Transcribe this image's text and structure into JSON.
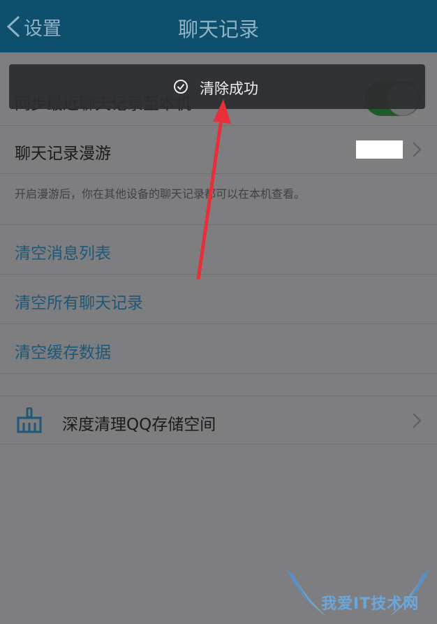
{
  "header": {
    "back_label": "设置",
    "title": "聊天记录"
  },
  "settings": {
    "sync_label": "同步最近聊天记录至本机",
    "sync_enabled": true,
    "roaming_label": "聊天记录漫游",
    "roaming_hint": "开启漫游后，你在其他设备的聊天记录都可以在本机查看。",
    "clear_message_list": "清空消息列表",
    "clear_all_chats": "清空所有聊天记录",
    "clear_cache": "清空缓存数据",
    "deep_clean": "深度清理QQ存储空间"
  },
  "toast": {
    "text": "清除成功",
    "icon": "check-circle-icon"
  },
  "annotation": {
    "arrow_color": "#e8303b"
  },
  "watermark": {
    "text": "我爱IT技术网"
  },
  "colors": {
    "titlebar": "#0e4f6d",
    "link_text": "#1d5878",
    "toggle_on": "#1f5a2c"
  }
}
